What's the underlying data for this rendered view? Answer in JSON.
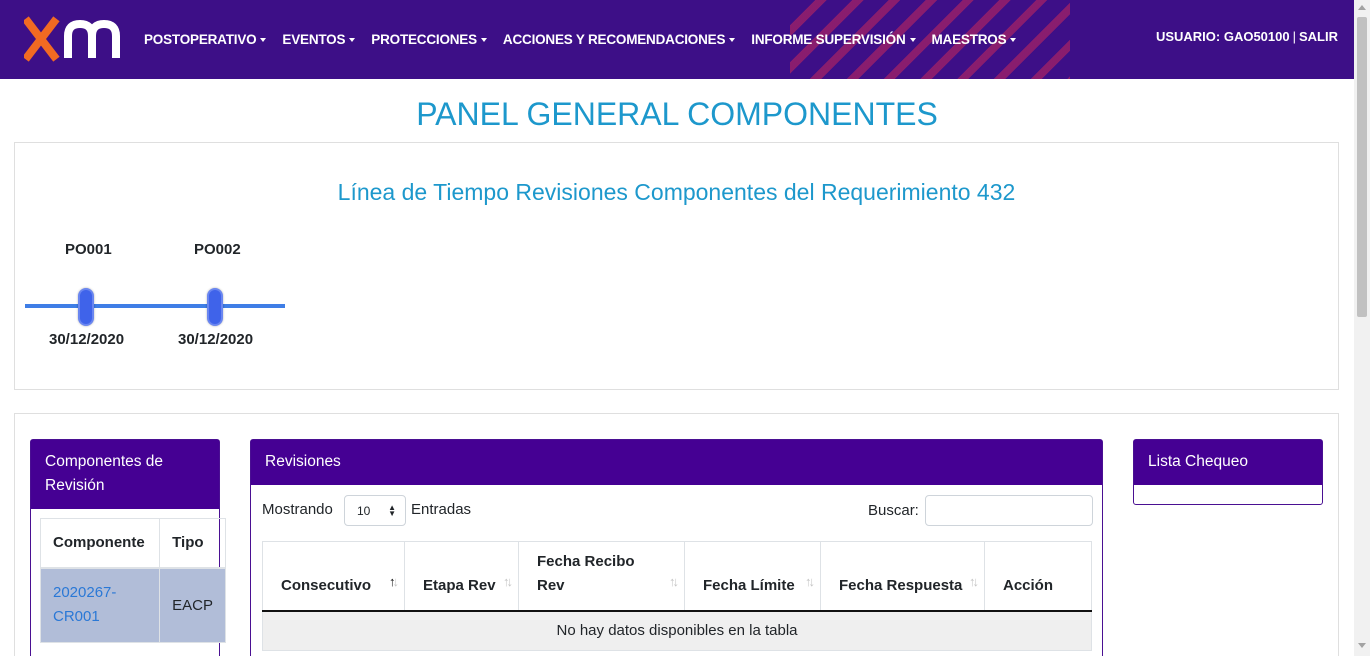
{
  "brand": {
    "logo_icon": "xm-logo-icon",
    "accent": "#3d0f87",
    "logo_colors": [
      "#f26a22",
      "#ffffff"
    ]
  },
  "nav": {
    "items": [
      {
        "label": "POSTOPERATIVO"
      },
      {
        "label": "EVENTOS"
      },
      {
        "label": "PROTECCIONES"
      },
      {
        "label": "ACCIONES Y RECOMENDACIONES"
      },
      {
        "label": "INFORME SUPERVISIÓN"
      },
      {
        "label": "MAESTROS"
      }
    ],
    "user_label": "USUARIO: GAO50100",
    "separator": "|",
    "logout_label": "SALIR"
  },
  "page": {
    "title": "PANEL GENERAL COMPONENTES"
  },
  "timeline": {
    "title": "Línea de Tiempo Revisiones Componentes del Requerimiento 432",
    "points": [
      {
        "code": "PO001",
        "date": "30/12/2020"
      },
      {
        "code": "PO002",
        "date": "30/12/2020"
      }
    ],
    "line_color": "#3f7ee6"
  },
  "components": {
    "title": "Componentes de Revisión",
    "columns": [
      "Componente",
      "Tipo"
    ],
    "rows": [
      {
        "componente": "2020267-CR001",
        "tipo": "EACP"
      }
    ],
    "selected_row_color": "#b1bdd8"
  },
  "revisions": {
    "title": "Revisiones",
    "length_label": "Mostrando",
    "length_value": "10",
    "entries_label": "Entradas",
    "search_label": "Buscar:",
    "search_value": "",
    "columns": [
      "Consecutivo",
      "Etapa Rev",
      "Fecha Recibo Rev",
      "Fecha Límite",
      "Fecha Respuesta",
      "Acción"
    ],
    "empty_message": "No hay datos disponibles en la tabla"
  },
  "checklist": {
    "title": "Lista Chequeo"
  },
  "colors": {
    "panel_header": "#450093",
    "title_blue": "#1d98cc"
  }
}
